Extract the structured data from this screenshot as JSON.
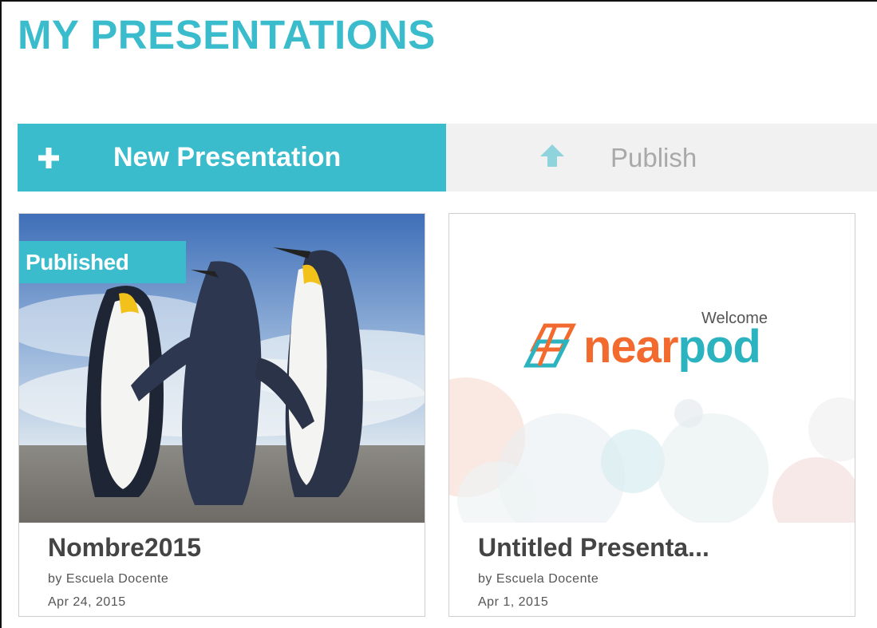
{
  "page": {
    "title": "MY PRESENTATIONS"
  },
  "toolbar": {
    "new_label": "New Presentation",
    "publish_label": "Publish",
    "new_icon": "plus-icon",
    "publish_icon": "upload-arrow-icon"
  },
  "colors": {
    "accent": "#3bbccc",
    "toolbar_inactive_bg": "#f1f1f1",
    "nearpod_orange": "#f26a2e",
    "nearpod_teal": "#2bb3c0"
  },
  "presentations": [
    {
      "title": "Nombre2015",
      "author": "by Escuela Docente",
      "date": "Apr 24, 2015",
      "badge": "Published",
      "thumbnail": "penguins-photo"
    },
    {
      "title": "Untitled Presenta...",
      "author": "by Escuela Docente",
      "date": "Apr 1, 2015",
      "thumbnail": "nearpod-welcome",
      "thumb_welcome": "Welcome",
      "thumb_brand_near": "near",
      "thumb_brand_pod": "pod"
    }
  ]
}
